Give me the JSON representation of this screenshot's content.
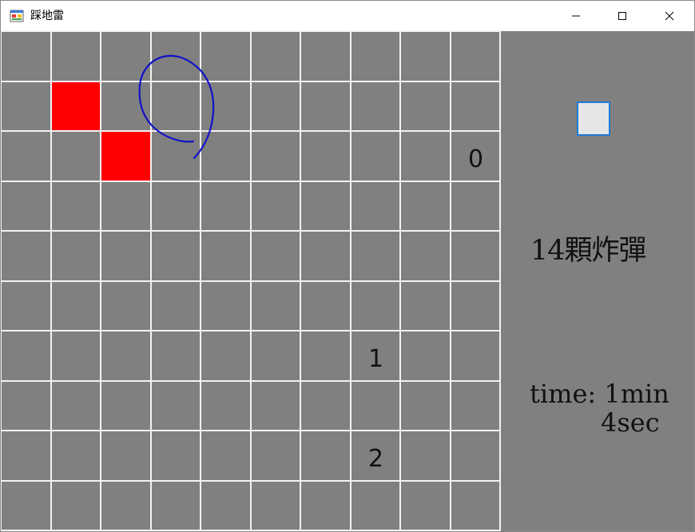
{
  "window": {
    "title": "踩地雷",
    "icon": "app-window-icon",
    "controls": [
      {
        "name": "minimize-button",
        "icon": "minimize-icon"
      },
      {
        "name": "maximize-button",
        "icon": "maximize-icon"
      },
      {
        "name": "close-button",
        "icon": "close-icon"
      }
    ]
  },
  "board": {
    "rows": 10,
    "cols": 10,
    "cells": [
      {
        "row": 1,
        "col": 1,
        "state": "flagged-red"
      },
      {
        "row": 2,
        "col": 2,
        "state": "flagged-red"
      },
      {
        "row": 2,
        "col": 9,
        "state": "number",
        "text": "0"
      },
      {
        "row": 6,
        "col": 7,
        "state": "number",
        "text": "1"
      },
      {
        "row": 8,
        "col": 7,
        "state": "number",
        "text": "2"
      }
    ],
    "colors": {
      "cell": "#808080",
      "grid": "#f2f2f2",
      "flag": "#ff0000"
    }
  },
  "side": {
    "reset_button_icon": "blank-square-icon",
    "bomb_count": "14顆炸彈",
    "time_line1": "time: 1min",
    "time_line2": "4sec"
  },
  "annotation": {
    "type": "hand-drawn-blue-loop",
    "color": "#1212c8"
  }
}
